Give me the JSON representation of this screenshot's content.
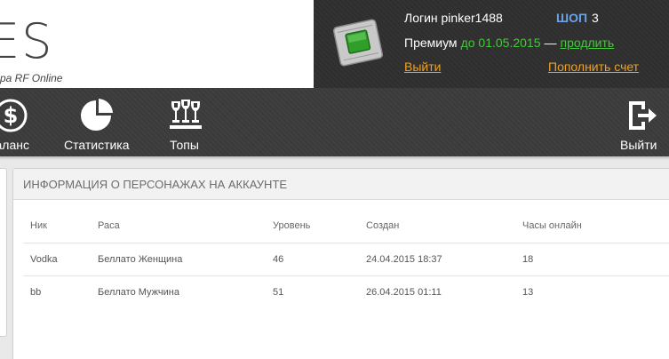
{
  "logo": {
    "letters": "ES",
    "subtitle": "pa RF Online"
  },
  "account": {
    "login_text": "Логин pinker1488",
    "shop_label": "ШОП",
    "shop_count": "3",
    "premium_label": "Премиум",
    "premium_until": "до 01.05.2015",
    "premium_dash": "—",
    "extend_link": "продлить",
    "logout_link": "Выйти",
    "topup_link": "Пополнить счет"
  },
  "nav": {
    "items": [
      {
        "label": "Баланс",
        "icon": "dollar-icon"
      },
      {
        "label": "Статистика",
        "icon": "pie-chart-icon"
      },
      {
        "label": "Топы",
        "icon": "trophies-icon"
      }
    ],
    "exit": {
      "label": "Выйти",
      "icon": "exit-icon"
    }
  },
  "characters": {
    "title": "ИНФОРМАЦИЯ О ПЕРСОНАЖАХ НА АККАУНТЕ",
    "columns": [
      "Ник",
      "Раса",
      "Уровень",
      "Создан",
      "Часы онлайн"
    ],
    "rows": [
      [
        "Vodka",
        "Беллато Женщина",
        "46",
        "24.04.2015 18:37",
        "18"
      ],
      [
        "bb",
        "Беллато Мужчина",
        "51",
        "26.04.2015 01:11",
        "13"
      ]
    ]
  },
  "colors": {
    "header_dark": "#2e2e2e",
    "premium_green": "#43c93a",
    "link_orange": "#f0a020",
    "shop_blue": "#6aa3e8"
  }
}
